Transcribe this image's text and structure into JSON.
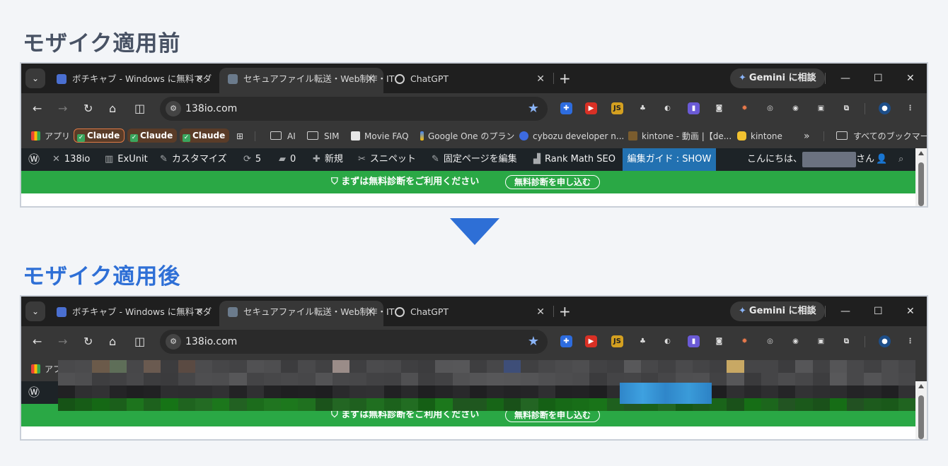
{
  "headings": {
    "before": "モザイク適用前",
    "after": "モザイク適用後"
  },
  "browser": {
    "tabs": [
      {
        "title": "ボチキャブ - Windows に無料でダ",
        "active": false,
        "favicon_color": "#4a6fd1"
      },
      {
        "title": "セキュアファイル転送・Web制作・IT",
        "active": true,
        "favicon_color": "#6b7b8c"
      },
      {
        "title": "ChatGPT",
        "active": false,
        "favicon_color": "#cfcfcf"
      }
    ],
    "new_tab_label": "+",
    "gemini_label": "Gemini に相談",
    "url": "138io.com",
    "bookmarks": [
      {
        "label": "アプリ",
        "type": "apps"
      },
      {
        "label": "Claude",
        "type": "chip"
      },
      {
        "label": "Claude",
        "type": "chip"
      },
      {
        "label": "Claude",
        "type": "chip"
      },
      {
        "label": "AI",
        "type": "folder"
      },
      {
        "label": "SIM",
        "type": "folder"
      },
      {
        "label": "Movie FAQ",
        "type": "link"
      },
      {
        "label": "Google One のプラン",
        "type": "link"
      },
      {
        "label": "cybozu developer n...",
        "type": "link"
      },
      {
        "label": "kintone - 動画 |【de...",
        "type": "link"
      },
      {
        "label": "kintone",
        "type": "link"
      },
      {
        "label": "»",
        "type": "more"
      },
      {
        "label": "すべてのブックマーク",
        "type": "folder"
      }
    ],
    "bookmarks_visible_after": "アプ"
  },
  "wp_admin_bar": {
    "site": "138io",
    "exunit": "ExUnit",
    "customize": "カスタマイズ",
    "updates": "5",
    "comments": "0",
    "new": "新規",
    "snippets": "スニペット",
    "edit_page": "固定ページを編集",
    "rank_math": "Rank Math SEO",
    "guide": "編集ガイド : SHOW",
    "greeting_prefix": "こんにちは、",
    "greeting_suffix": "さん"
  },
  "notice": {
    "message": "まずは無料診断をご利用ください",
    "button": "無料診断を申し込む"
  },
  "colors": {
    "heading_before": "#485264",
    "heading_after": "#2e6fd6",
    "notice_green": "#2aa845",
    "wp_bar": "#1d2327",
    "guide_blue": "#2271b1"
  }
}
